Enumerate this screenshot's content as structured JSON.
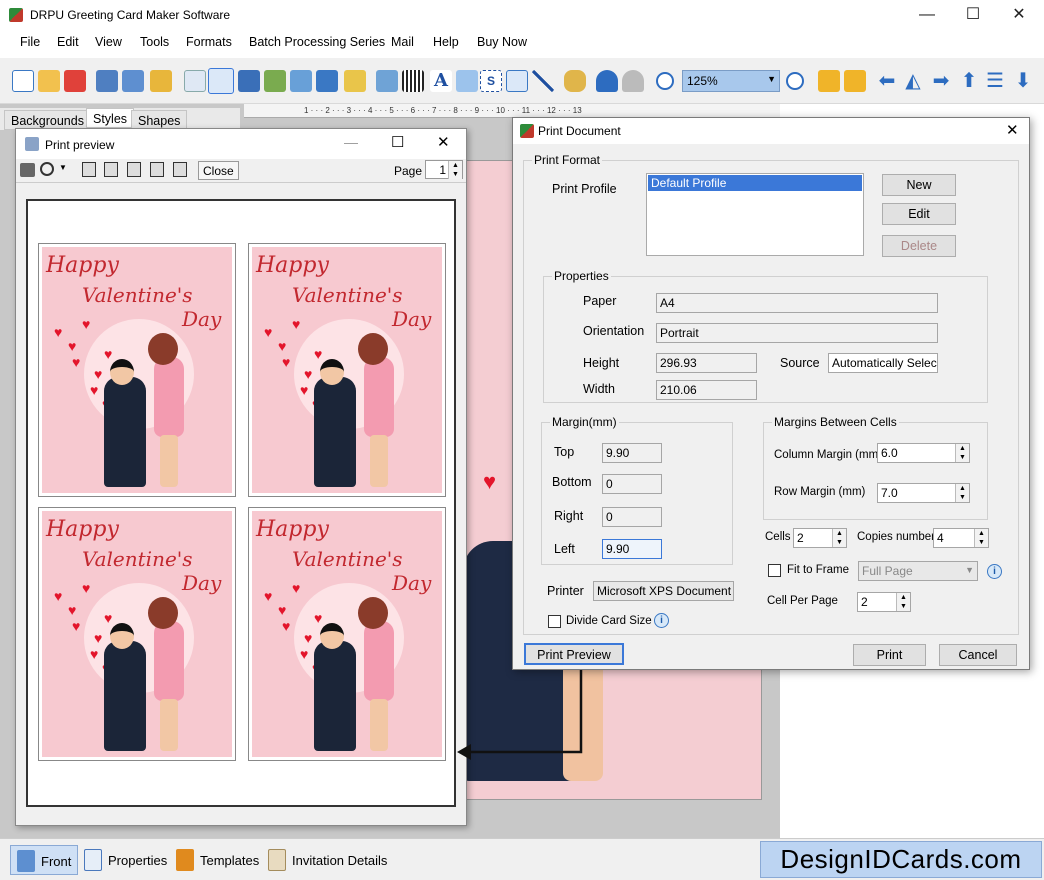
{
  "app": {
    "title": "DRPU Greeting Card Maker Software"
  },
  "menu": [
    "File",
    "Edit",
    "View",
    "Tools",
    "Formats",
    "Batch Processing Series",
    "Mail",
    "Help",
    "Buy Now"
  ],
  "toolbar": {
    "zoom": "125%"
  },
  "left_tabs": [
    "Backgrounds",
    "Styles",
    "Shapes"
  ],
  "ruler": "1 · · · 2 · · · 3 · · · 4 · · · 5 · · · 6 · · · 7 · · · 8 · · · 9 · · · 10 · · · 11 · · · 12 · · · 13",
  "print_preview": {
    "title": "Print preview",
    "close_label": "Close",
    "page_label": "Page",
    "page_value": "1",
    "card": {
      "line1": "Happy",
      "line2": "Valentine's",
      "line3": "Day"
    }
  },
  "print_dialog": {
    "title": "Print Document",
    "print_format": "Print Format",
    "print_profile_label": "Print Profile",
    "profiles": [
      "Default Profile"
    ],
    "new": "New",
    "edit": "Edit",
    "delete": "Delete",
    "properties": "Properties",
    "paper_label": "Paper",
    "paper": "A4",
    "orientation_label": "Orientation",
    "orientation": "Portrait",
    "height_label": "Height",
    "height": "296.93",
    "width_label": "Width",
    "width": "210.06",
    "source_label": "Source",
    "source": "Automatically Selec",
    "margin_group": "Margin(mm)",
    "top_label": "Top",
    "top": "9.90",
    "bottom_label": "Bottom",
    "bottom": "0",
    "right_label": "Right",
    "right": "0",
    "left_label": "Left",
    "left": "9.90",
    "cells_group": "Margins Between Cells",
    "column_margin_label": "Column Margin (mm)",
    "column_margin": "6.0",
    "row_margin_label": "Row Margin (mm)",
    "row_margin": "7.0",
    "cells_label": "Cells",
    "cells": "2",
    "copies_label": "Copies number",
    "copies": "4",
    "fit_to_frame": "Fit to Frame",
    "fit_option": "Full Page",
    "cell_per_page_label": "Cell Per Page",
    "cell_per_page": "2",
    "printer_label": "Printer",
    "printer": "Microsoft XPS Document",
    "divide_card": "Divide Card Size",
    "print_preview_btn": "Print Preview",
    "print_btn": "Print",
    "cancel_btn": "Cancel"
  },
  "bottom_tabs": [
    "Front",
    "Properties",
    "Templates",
    "Invitation Details"
  ],
  "brand": "DesignIDCards.com",
  "colors": {
    "accent": "#3b78d8",
    "card_pink": "#f7c9d0",
    "text_red": "#c2282f"
  }
}
